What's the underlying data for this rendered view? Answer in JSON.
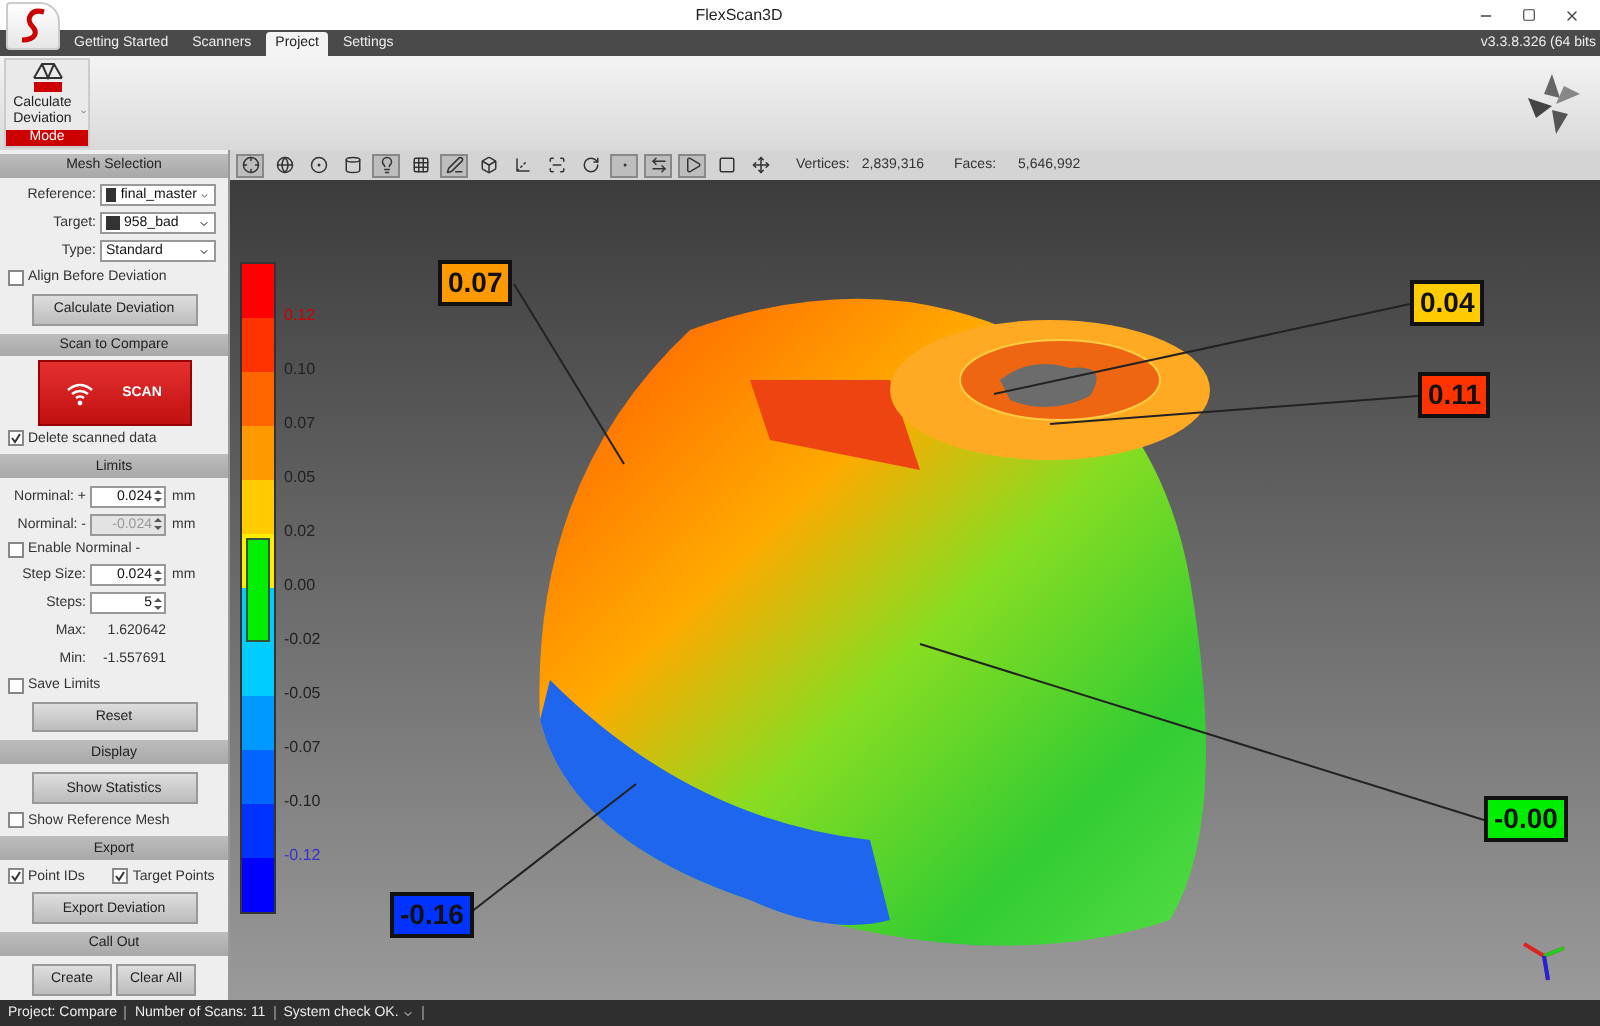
{
  "window": {
    "title": "FlexScan3D",
    "version": "v3.3.8.326  (64 bits"
  },
  "tabs": [
    {
      "label": "Getting Started",
      "selected": false
    },
    {
      "label": "Scanners",
      "selected": false
    },
    {
      "label": "Project",
      "selected": true
    },
    {
      "label": "Settings",
      "selected": false
    }
  ],
  "ribbon": {
    "button": "Calculate Deviation",
    "group": "Mode"
  },
  "sidebar": {
    "mesh_selection": {
      "title": "Mesh Selection",
      "fields": [
        {
          "label": "Reference:",
          "value": "final_master",
          "icon": true
        },
        {
          "label": "Target:",
          "value": "958_bad",
          "icon": true
        },
        {
          "label": "Type:",
          "value": "Standard",
          "icon": false
        }
      ],
      "align": {
        "label": "Align Before Deviation",
        "checked": false
      },
      "button": "Calculate Deviation"
    },
    "scan": {
      "title": "Scan to Compare",
      "button": "SCAN",
      "delete": {
        "label": "Delete scanned data",
        "checked": true
      }
    },
    "limits": {
      "title": "Limits",
      "nominal_plus": {
        "label": "Norminal: +",
        "value": "0.024",
        "unit": "mm",
        "disabled": false
      },
      "nominal_minus": {
        "label": "Norminal: -",
        "value": "-0.024",
        "unit": "mm",
        "disabled": true
      },
      "enable": {
        "label": "Enable Norminal -",
        "checked": false
      },
      "step_size": {
        "label": "Step Size:",
        "value": "0.024",
        "unit": "mm",
        "disabled": false
      },
      "steps": {
        "label": "Steps:",
        "value": "5",
        "disabled": false
      },
      "max": {
        "label": "Max:",
        "value": "1.620642"
      },
      "min": {
        "label": "Min:",
        "value": "-1.557691"
      },
      "save": {
        "label": "Save Limits",
        "checked": false
      },
      "button": "Reset"
    },
    "display": {
      "title": "Display",
      "button": "Show Statistics",
      "show_reference": {
        "label": "Show Reference Mesh",
        "checked": false
      }
    },
    "export": {
      "title": "Export",
      "options": [
        {
          "label": "Point IDs",
          "checked": true
        },
        {
          "label": "Target Points",
          "checked": true
        }
      ],
      "button": "Export Deviation"
    },
    "call_out": {
      "title": "Call Out",
      "buttons": [
        "Create",
        "Clear All"
      ]
    }
  },
  "toolbar": {
    "tools": [
      {
        "kind": "target",
        "pressed": true
      },
      {
        "kind": "globe",
        "pressed": false
      },
      {
        "kind": "sphere",
        "pressed": false
      },
      {
        "kind": "cylinder",
        "pressed": false
      },
      {
        "kind": "bulb",
        "pressed": true
      },
      {
        "kind": "colors",
        "pressed": false
      },
      {
        "kind": "pen",
        "pressed": true
      },
      {
        "kind": "box",
        "pressed": false
      },
      {
        "kind": "axes",
        "pressed": false
      },
      {
        "kind": "dots",
        "pressed": false
      },
      {
        "kind": "rotate",
        "pressed": false
      },
      {
        "kind": "points",
        "pressed": true
      },
      {
        "kind": "align",
        "pressed": true
      },
      {
        "kind": "play",
        "pressed": true
      },
      {
        "kind": "stop",
        "pressed": false
      },
      {
        "kind": "move",
        "pressed": false
      }
    ],
    "vertices_label": "Vertices:",
    "vertices": "2,839,316",
    "faces_label": "Faces:",
    "faces": "5,646,992"
  },
  "legend": {
    "segments": [
      {
        "color": "#ff0000"
      },
      {
        "color": "#ff3300"
      },
      {
        "color": "#ff6600"
      },
      {
        "color": "#ff9900"
      },
      {
        "color": "#ffcc00"
      },
      {
        "color": "#ffee00"
      },
      {
        "color": "#00ccff"
      },
      {
        "color": "#00ccff"
      },
      {
        "color": "#0099ff"
      },
      {
        "color": "#0066ff"
      },
      {
        "color": "#0033ff"
      },
      {
        "color": "#0000ff"
      }
    ],
    "ticks": [
      {
        "label": "0.12",
        "color": "#cc0000"
      },
      {
        "label": "0.10",
        "color": "#222222"
      },
      {
        "label": "0.07",
        "color": "#222222"
      },
      {
        "label": "0.05",
        "color": "#222222"
      },
      {
        "label": "0.02",
        "color": "#222222"
      },
      {
        "label": "0.00",
        "color": "#222222"
      },
      {
        "label": "-0.02",
        "color": "#222222"
      },
      {
        "label": "-0.05",
        "color": "#222222"
      },
      {
        "label": "-0.07",
        "color": "#222222"
      },
      {
        "label": "-0.10",
        "color": "#222222"
      },
      {
        "label": "-0.12",
        "color": "#3333cc"
      }
    ]
  },
  "callouts": [
    {
      "value": "0.07",
      "color": "#ff9900"
    },
    {
      "value": "0.04",
      "color": "#ffcc00"
    },
    {
      "value": "0.11",
      "color": "#ff3300"
    },
    {
      "value": "-0.00",
      "color": "#00ee00"
    },
    {
      "value": "-0.16",
      "color": "#0033ff"
    }
  ],
  "status_bar": {
    "project": "Project:  Compare",
    "scans": "Number of Scans:  11",
    "system": "System check OK."
  }
}
